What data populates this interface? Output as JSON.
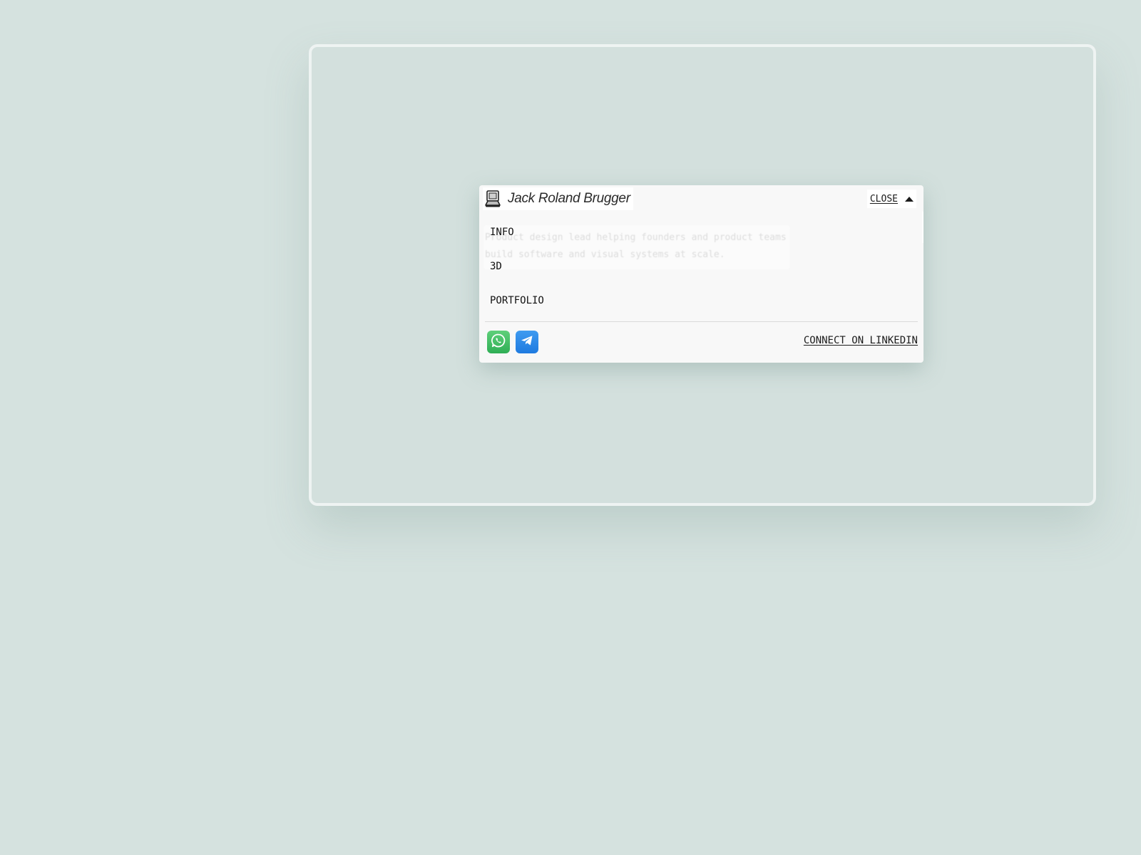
{
  "header": {
    "brand_name": "Jack Roland Brugger",
    "brand_icon": "laptop-icon",
    "close_label": "CLOSE",
    "close_icon": "caret-up-icon"
  },
  "tagline": "Product design lead helping founders and product teams build software and visual systems at scale.",
  "nav": {
    "items": [
      {
        "label": "INFO"
      },
      {
        "label": "3D"
      },
      {
        "label": "PORTFOLIO"
      }
    ]
  },
  "footer": {
    "social": [
      {
        "icon": "whatsapp-icon",
        "color": "#3bbd60"
      },
      {
        "icon": "telegram-icon",
        "color": "#2a8cea"
      }
    ],
    "linkedin_label": "CONNECT ON LINKEDIN"
  },
  "colors": {
    "background": "#d5e2df",
    "panel": "#f8f8f8"
  }
}
